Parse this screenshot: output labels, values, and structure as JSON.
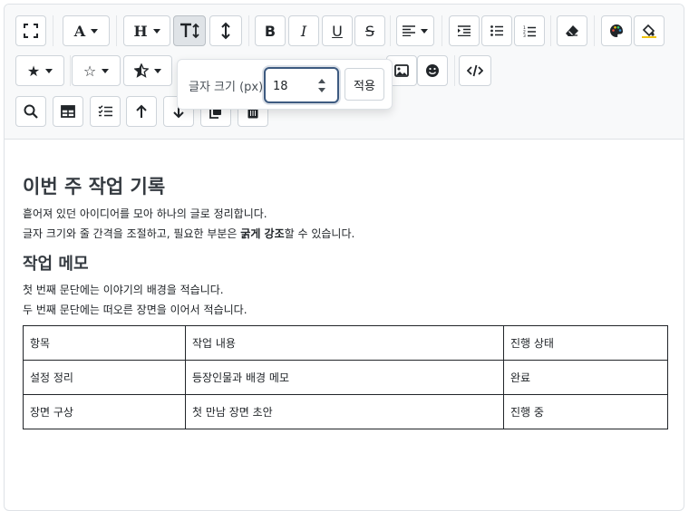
{
  "toolbar": {
    "font_size_popover": {
      "label": "글자 크기 (px)",
      "value": "18",
      "apply_label": "적용"
    },
    "heading_letter": "H",
    "font_letter": "A"
  },
  "document": {
    "title": "이번 주 작업 기록",
    "intro_line1": "흩어져 있던 아이디어를 모아 하나의 글로 정리합니다.",
    "intro_line2_before": "글자 크기와 줄 간격을 조절하고, 필요한 부분은 ",
    "intro_line2_bold": "굵게 강조",
    "intro_line2_after": "할 수 있습니다.",
    "section_title": "작업 메모",
    "memo_line1": "첫 번째 문단에는 이야기의 배경을 적습니다.",
    "memo_line2": "두 번째 문단에는 떠오른 장면을 이어서 적습니다.",
    "table": {
      "headers": [
        "항목",
        "작업 내용",
        "진행 상태"
      ],
      "rows": [
        [
          "설정 정리",
          "등장인물과 배경 메모",
          "완료"
        ],
        [
          "장면 구상",
          "첫 만남 장면 초안",
          "진행 중"
        ]
      ]
    }
  }
}
